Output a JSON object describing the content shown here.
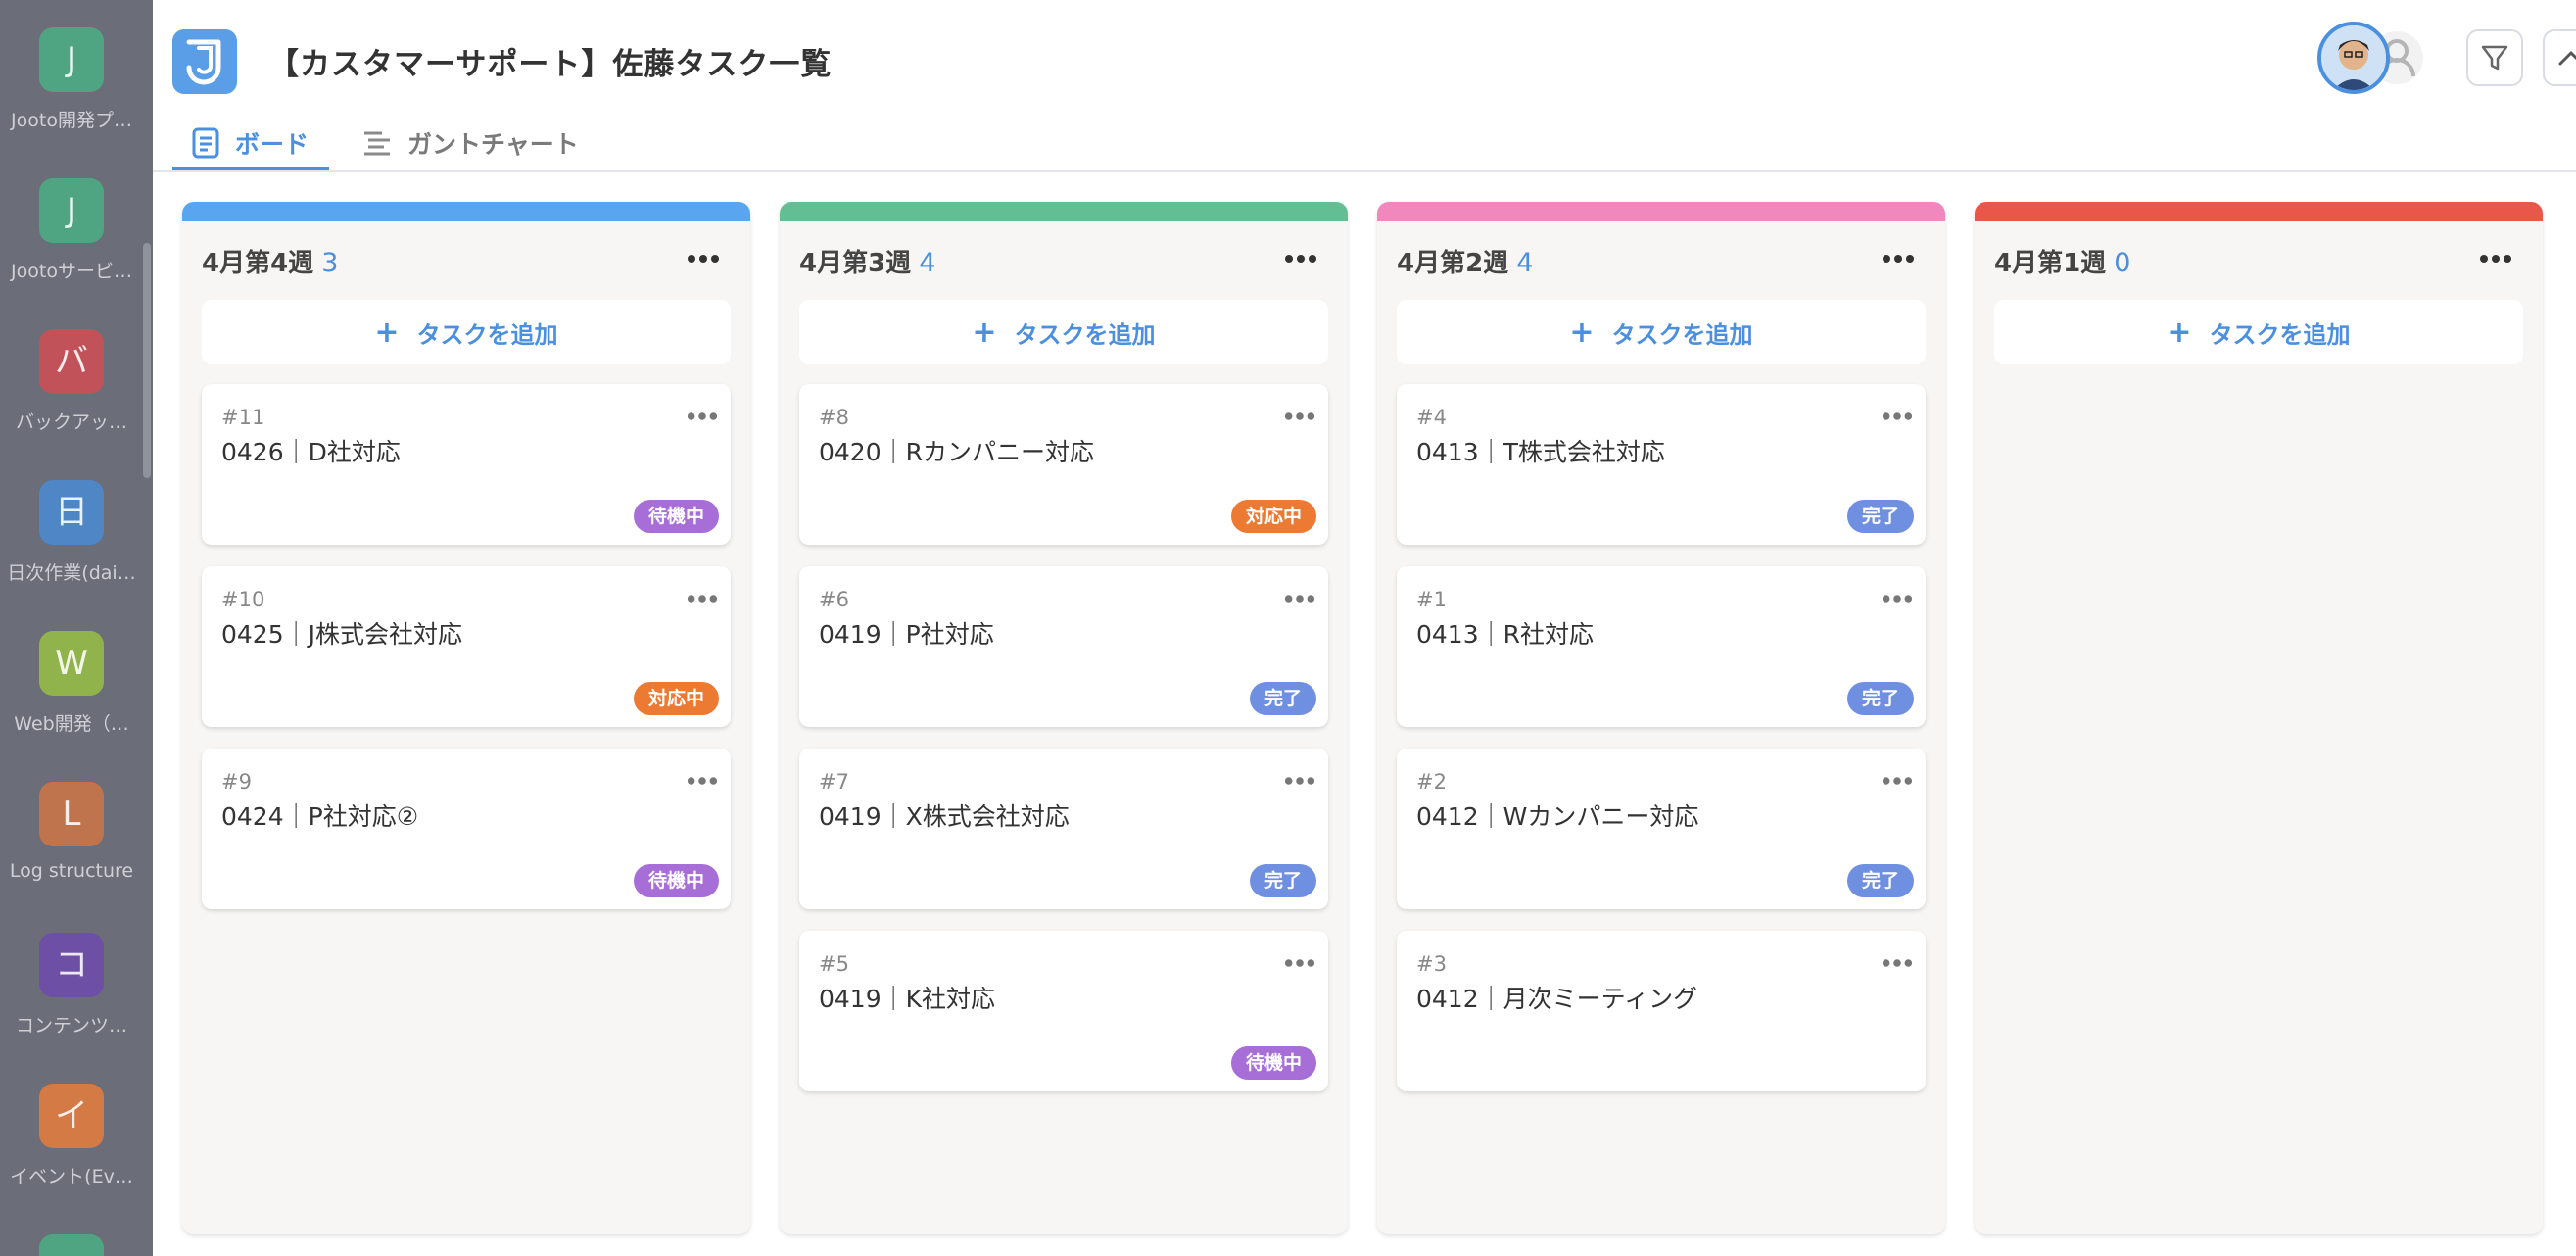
{
  "app": {
    "title": "【カスタマーサポート】佐藤タスク一覧",
    "tabs": [
      {
        "label": "ボード",
        "active": true
      },
      {
        "label": "ガントチャート",
        "active": false
      }
    ]
  },
  "rail": {
    "projects": [
      {
        "initial": "J",
        "label": "Jooto開発プ…",
        "color": "#4fa582"
      },
      {
        "initial": "J",
        "label": "Jootoサービ…",
        "color": "#4fa582"
      },
      {
        "initial": "バ",
        "label": "バックアッ…",
        "color": "#c2525a"
      },
      {
        "initial": "日",
        "label": "日次作業(dai…",
        "color": "#4f86c6"
      },
      {
        "initial": "W",
        "label": "Web開発（…",
        "color": "#91b34c"
      },
      {
        "initial": "L",
        "label": "Log structure",
        "color": "#c0744e"
      },
      {
        "initial": "コ",
        "label": "コンテンツ…",
        "color": "#6e4fa6"
      },
      {
        "initial": "イ",
        "label": "イベント(Ev…",
        "color": "#d37a45"
      },
      {
        "initial": "",
        "label": "",
        "color": "#4fa582"
      }
    ]
  },
  "board": {
    "add_task_label": "タスクを追加",
    "columns": [
      {
        "title": "4月第4週",
        "count": "3",
        "color": "#5aa5ef",
        "cards": [
          {
            "num": "#11",
            "title": "0426｜D社対応",
            "status": "待機中",
            "status_color": "#a86ed8"
          },
          {
            "num": "#10",
            "title": "0425｜J株式会社対応",
            "status": "対応中",
            "status_color": "#ec7a32"
          },
          {
            "num": "#9",
            "title": "0424｜P社対応②",
            "status": "待機中",
            "status_color": "#a86ed8"
          }
        ]
      },
      {
        "title": "4月第3週",
        "count": "4",
        "color": "#62bf93",
        "cards": [
          {
            "num": "#8",
            "title": "0420｜Rカンパニー対応",
            "status": "対応中",
            "status_color": "#ec7a32"
          },
          {
            "num": "#6",
            "title": "0419｜P社対応",
            "status": "完了",
            "status_color": "#6f8fe0"
          },
          {
            "num": "#7",
            "title": "0419｜X株式会社対応",
            "status": "完了",
            "status_color": "#6f8fe0"
          },
          {
            "num": "#5",
            "title": "0419｜K社対応",
            "status": "待機中",
            "status_color": "#a86ed8"
          }
        ]
      },
      {
        "title": "4月第2週",
        "count": "4",
        "color": "#f087bd",
        "cards": [
          {
            "num": "#4",
            "title": "0413｜T株式会社対応",
            "status": "完了",
            "status_color": "#6f8fe0"
          },
          {
            "num": "#1",
            "title": "0413｜R社対応",
            "status": "完了",
            "status_color": "#6f8fe0"
          },
          {
            "num": "#2",
            "title": "0412｜Wカンパニー対応",
            "status": "完了",
            "status_color": "#6f8fe0"
          },
          {
            "num": "#3",
            "title": "0412｜月次ミーティング",
            "status": "",
            "status_color": ""
          }
        ]
      },
      {
        "title": "4月第1週",
        "count": "0",
        "color": "#e8574a",
        "cards": []
      }
    ]
  },
  "icons": {
    "logo": "jooto-logo-icon",
    "board_tab": "board-list-icon",
    "gantt_tab": "gantt-bars-icon",
    "filter": "filter-funnel-icon",
    "collapse": "chevron-up-icon",
    "menu": "more-dots-icon"
  }
}
